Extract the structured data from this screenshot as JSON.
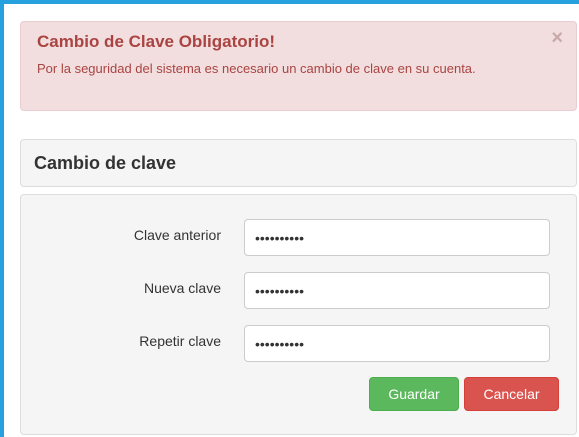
{
  "alert": {
    "title": "Cambio de Clave Obligatorio!",
    "message": "Por la seguridad del sistema es necesario un cambio de clave en su cuenta.",
    "close_symbol": "×",
    "colors": {
      "background": "#f2dede",
      "text": "#a94442"
    }
  },
  "panel": {
    "title": "Cambio de clave"
  },
  "form": {
    "old_password": {
      "label": "Clave anterior",
      "value": "1234567890"
    },
    "new_password": {
      "label": "Nueva clave",
      "value": "1234567890"
    },
    "repeat_password": {
      "label": "Repetir clave",
      "value": "1234567890"
    }
  },
  "buttons": {
    "save": {
      "label": "Guardar",
      "color": "#5cb85c"
    },
    "cancel": {
      "label": "Cancelar",
      "color": "#d9534f"
    }
  },
  "icons": {
    "close": "close-icon"
  }
}
